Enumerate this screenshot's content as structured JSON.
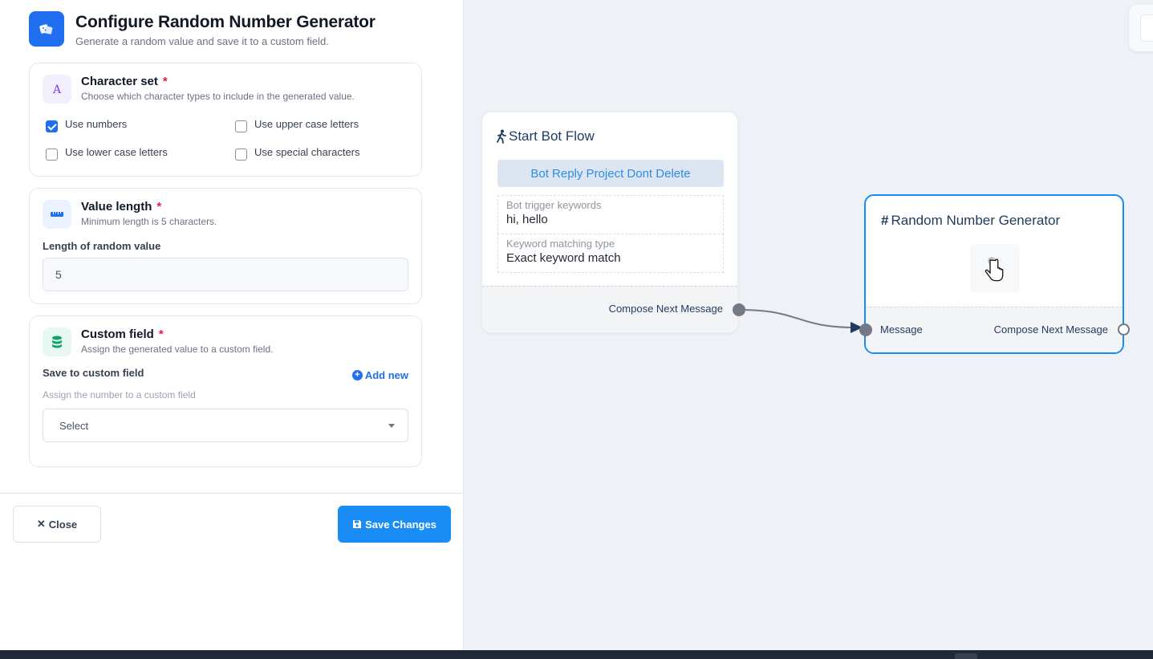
{
  "panel": {
    "title": "Configure Random Number Generator",
    "subtitle": "Generate a random value and save it to a custom field.",
    "character_set": {
      "title": "Character set",
      "required_mark": "*",
      "description": "Choose which character types to include in the generated value.",
      "options": [
        {
          "label": "Use numbers",
          "checked": true
        },
        {
          "label": "Use upper case letters",
          "checked": false
        },
        {
          "label": "Use lower case letters",
          "checked": false
        },
        {
          "label": "Use special characters",
          "checked": false
        }
      ]
    },
    "value_length": {
      "title": "Value length",
      "required_mark": "*",
      "description": "Minimum length is 5 characters.",
      "field_label": "Length of random value",
      "value": "5"
    },
    "custom_field": {
      "title": "Custom field",
      "required_mark": "*",
      "description": "Assign the generated value to a custom field.",
      "field_label": "Save to custom field",
      "add_new_label": "Add new",
      "hint": "Assign the number to a custom field",
      "select_value": "Select"
    },
    "footer": {
      "close_label": "Close",
      "close_glyph": "✕",
      "save_label": "Save Changes"
    }
  },
  "canvas": {
    "start_node": {
      "title": "Start Bot Flow",
      "project": "Bot Reply Project Dont Delete",
      "trigger_keywords_label": "Bot trigger keywords",
      "trigger_keywords_value": "hi, hello",
      "matching_type_label": "Keyword matching type",
      "matching_type_value": "Exact keyword match",
      "out_port_label": "Compose Next Message"
    },
    "rng_node": {
      "title_glyph": "#",
      "title": "Random Number Generator",
      "in_port_label": "Message",
      "out_port_label": "Compose Next Message"
    }
  },
  "colors": {
    "accent": "#1f6ff0",
    "save_button": "#1a8cf5",
    "selected_node_border": "#1a8cf5",
    "required": "#e11d48",
    "connector": "#737a86"
  },
  "icons": {
    "header": "dice-icon",
    "character_set": "font-letter-icon",
    "value_length": "ruler-icon",
    "custom_field": "database-icon",
    "save": "floppy-disk-icon",
    "start_node": "walking-person-icon"
  }
}
